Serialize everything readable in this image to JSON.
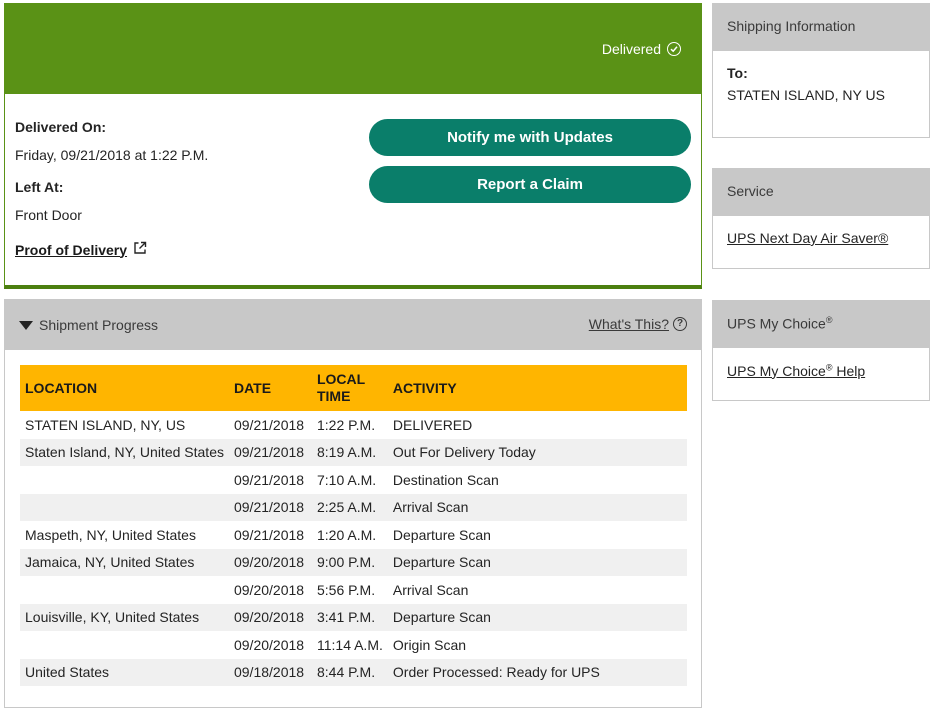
{
  "delivery": {
    "status": "Delivered",
    "delivered_on_label": "Delivered On:",
    "delivered_on_value": "Friday, 09/21/2018 at 1:22 P.M.",
    "left_at_label": "Left At:",
    "left_at_value": "Front Door",
    "proof_link": "Proof of Delivery",
    "notify_button": "Notify me with Updates",
    "claim_button": "Report a Claim"
  },
  "progress": {
    "title": "Shipment Progress",
    "help_link": "What's This?",
    "headers": {
      "location": "LOCATION",
      "date": "DATE",
      "time_line1": "LOCAL",
      "time_line2": "TIME",
      "activity": "ACTIVITY"
    },
    "rows": [
      {
        "location": "STATEN ISLAND, NY, US",
        "date": "09/21/2018",
        "time": "1:22 P.M.",
        "activity": "DELIVERED"
      },
      {
        "location": "Staten Island, NY, United States",
        "date": "09/21/2018",
        "time": "8:19 A.M.",
        "activity": "Out For Delivery Today"
      },
      {
        "location": "",
        "date": "09/21/2018",
        "time": "7:10 A.M.",
        "activity": "Destination Scan"
      },
      {
        "location": "",
        "date": "09/21/2018",
        "time": "2:25 A.M.",
        "activity": "Arrival Scan"
      },
      {
        "location": "Maspeth, NY, United States",
        "date": "09/21/2018",
        "time": "1:20 A.M.",
        "activity": "Departure Scan"
      },
      {
        "location": "Jamaica, NY, United States",
        "date": "09/20/2018",
        "time": "9:00 P.M.",
        "activity": "Departure Scan"
      },
      {
        "location": "",
        "date": "09/20/2018",
        "time": "5:56 P.M.",
        "activity": "Arrival Scan"
      },
      {
        "location": "Louisville, KY, United States",
        "date": "09/20/2018",
        "time": "3:41 P.M.",
        "activity": "Departure Scan"
      },
      {
        "location": "",
        "date": "09/20/2018",
        "time": "11:14 A.M.",
        "activity": "Origin Scan"
      },
      {
        "location": "United States",
        "date": "09/18/2018",
        "time": "8:44 P.M.",
        "activity": "Order Processed: Ready for UPS"
      }
    ]
  },
  "shipping_info": {
    "title": "Shipping Information",
    "to_label": "To:",
    "to_value": "STATEN ISLAND, NY US"
  },
  "service": {
    "title": "Service",
    "link": "UPS Next Day Air Saver®"
  },
  "my_choice": {
    "title": "UPS My Choice",
    "title_sup": "®",
    "link": "UPS My Choice",
    "link_sup": "®",
    "link_suffix": " Help"
  },
  "colors": {
    "banner_green": "#5a9216",
    "button_teal": "#0a7e6a",
    "table_header_gold": "#ffb500",
    "panel_gray": "#c8c8c8"
  }
}
